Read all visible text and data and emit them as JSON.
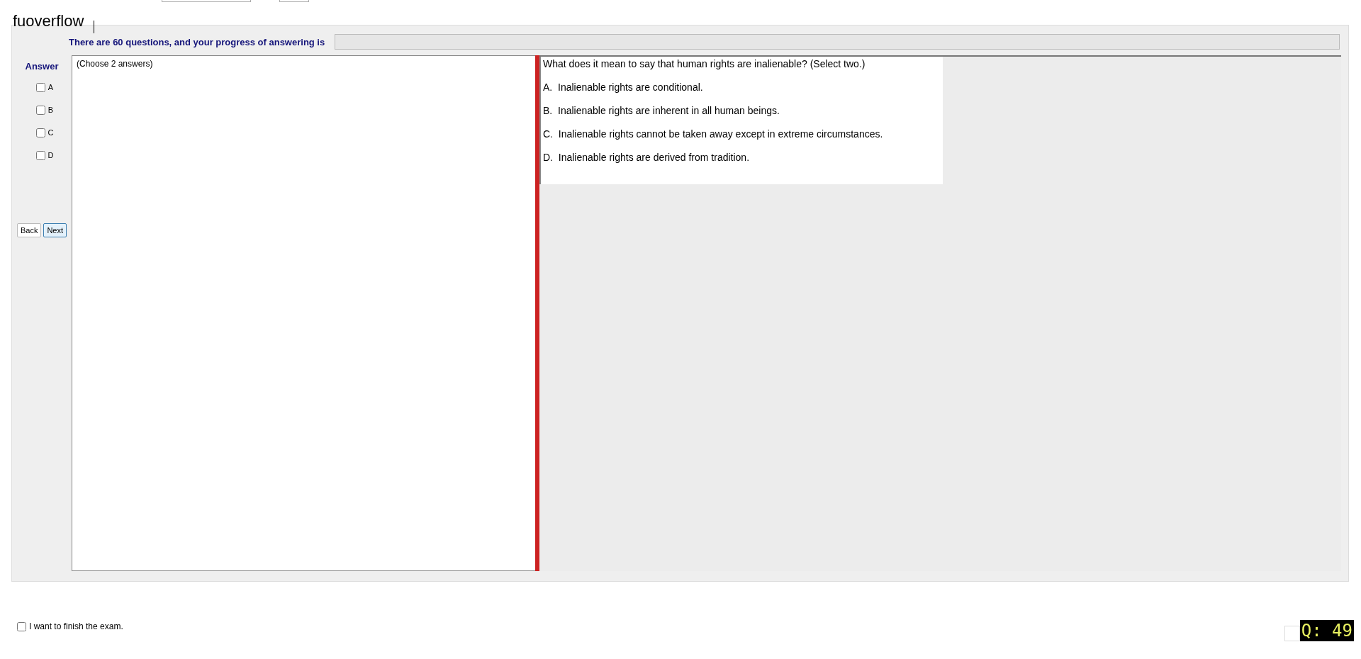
{
  "title": "fuoverflow",
  "progress": {
    "label": "There are 60 questions, and your progress of answering is",
    "level": 0
  },
  "answer": {
    "heading": "Answer",
    "options": [
      {
        "label": "A",
        "checked": false
      },
      {
        "label": "B",
        "checked": false
      },
      {
        "label": "C",
        "checked": false
      },
      {
        "label": "D",
        "checked": false
      }
    ]
  },
  "buttons": [
    {
      "label": "Back",
      "selected": false
    },
    {
      "label": "Next",
      "selected": true
    }
  ],
  "answer_area": {
    "value": "(Choose 2 answers)"
  },
  "question": {
    "text": "What does it mean to say that human rights are inalienable? (Select two.)",
    "choices": [
      "A.  Inalienable rights are conditional.",
      "B.  Inalienable rights are inherent in all human beings.",
      "C.  Inalienable rights cannot be taken away except in extreme circumstances.",
      "D.  Inalienable rights are derived from tradition."
    ]
  },
  "finish": {
    "label": "I want to finish the exam.",
    "checked": false
  },
  "question_counter": "Q: 49"
}
